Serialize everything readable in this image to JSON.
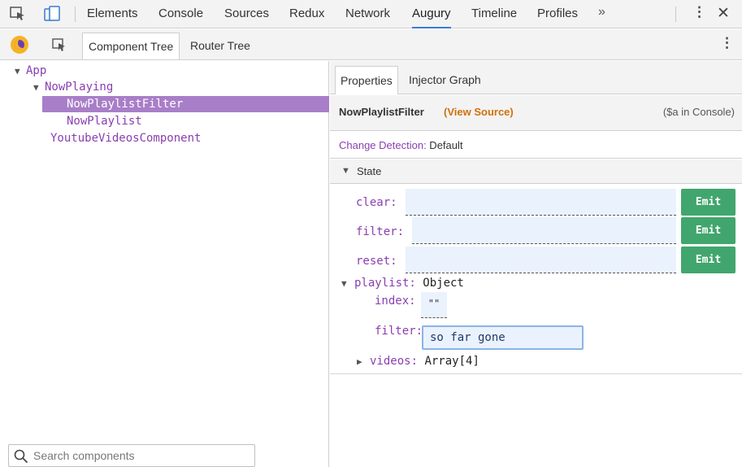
{
  "devtools": {
    "tabs": [
      "Elements",
      "Console",
      "Sources",
      "Redux",
      "Network",
      "Augury",
      "Timeline",
      "Profiles"
    ],
    "active_tab": "Augury",
    "more_label": "»",
    "menu_label": "⋮",
    "close_label": "✕"
  },
  "augury": {
    "tabs": [
      "Component Tree",
      "Router Tree"
    ],
    "menu_label": "⋮"
  },
  "tree": {
    "nodes": [
      {
        "label": "App",
        "caret": "▼"
      },
      {
        "label": "NowPlaying",
        "caret": "▼"
      },
      {
        "label": "NowPlaylistFilter",
        "caret": ""
      },
      {
        "label": "NowPlaylist",
        "caret": ""
      },
      {
        "label": "YoutubeVideosComponent",
        "caret": ""
      }
    ],
    "selected": "NowPlaylistFilter"
  },
  "search": {
    "placeholder": "Search components"
  },
  "panel": {
    "tabs": [
      "Properties",
      "Injector Graph"
    ],
    "component_name": "NowPlaylistFilter",
    "view_source_label": "(View Source)",
    "console_hint": "($a in Console)",
    "change_detection_label": "Change Detection:",
    "change_detection_value": " Default",
    "state_caret": "▼",
    "state_label": "State",
    "outputs": [
      {
        "key": "clear:",
        "button": "Emit"
      },
      {
        "key": "filter:",
        "button": "Emit"
      },
      {
        "key": "reset:",
        "button": "Emit"
      }
    ],
    "playlist": {
      "caret": "▼",
      "key": "playlist:",
      "value": " Object",
      "index_key": "index:",
      "index_value": "\"\"",
      "filter_key": "filter:",
      "filter_value": "so far gone",
      "videos_caret": "▶",
      "videos_key": "videos:",
      "videos_value": " Array[4]"
    }
  },
  "colors": {
    "selected_row": "#a97ec8",
    "emit_button": "#41a66d",
    "key_purple": "#8a3fb0",
    "view_source": "#d0700c",
    "active_tab_underline": "#3a7bd5"
  }
}
